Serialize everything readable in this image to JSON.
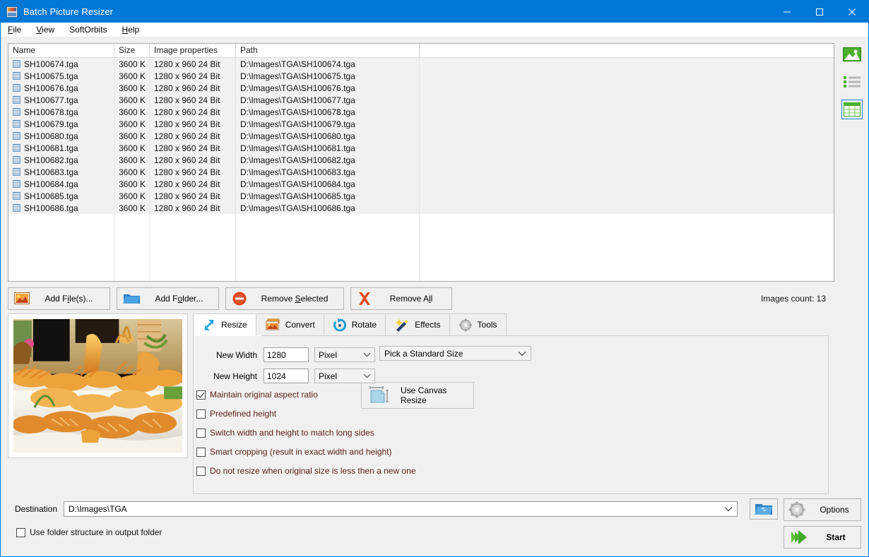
{
  "window": {
    "title": "Batch Picture Resizer",
    "app_icon": "app-icon",
    "minimize": "minimize-icon",
    "maximize": "maximize-icon",
    "close": "close-icon"
  },
  "menubar": {
    "items": [
      {
        "label": "File",
        "accel": "F"
      },
      {
        "label": "View",
        "accel": "V"
      },
      {
        "label": "SoftOrbits",
        "accel": "S"
      },
      {
        "label": "Help",
        "accel": "H"
      }
    ]
  },
  "filelist": {
    "columns": [
      "Name",
      "Size",
      "Image properties",
      "Path"
    ],
    "rows": [
      {
        "name": "SH100674.tga",
        "size": "3600 K",
        "props": "1280 x 960   24 Bit",
        "path": "D:\\Images\\TGA\\SH100674.tga"
      },
      {
        "name": "SH100675.tga",
        "size": "3600 K",
        "props": "1280 x 960   24 Bit",
        "path": "D:\\Images\\TGA\\SH100675.tga"
      },
      {
        "name": "SH100676.tga",
        "size": "3600 K",
        "props": "1280 x 960   24 Bit",
        "path": "D:\\Images\\TGA\\SH100676.tga"
      },
      {
        "name": "SH100677.tga",
        "size": "3600 K",
        "props": "1280 x 960   24 Bit",
        "path": "D:\\Images\\TGA\\SH100677.tga"
      },
      {
        "name": "SH100678.tga",
        "size": "3600 K",
        "props": "1280 x 960   24 Bit",
        "path": "D:\\Images\\TGA\\SH100678.tga"
      },
      {
        "name": "SH100679.tga",
        "size": "3600 K",
        "props": "1280 x 960   24 Bit",
        "path": "D:\\Images\\TGA\\SH100679.tga"
      },
      {
        "name": "SH100680.tga",
        "size": "3600 K",
        "props": "1280 x 960   24 Bit",
        "path": "D:\\Images\\TGA\\SH100680.tga"
      },
      {
        "name": "SH100681.tga",
        "size": "3600 K",
        "props": "1280 x 960   24 Bit",
        "path": "D:\\Images\\TGA\\SH100681.tga"
      },
      {
        "name": "SH100682.tga",
        "size": "3600 K",
        "props": "1280 x 960   24 Bit",
        "path": "D:\\Images\\TGA\\SH100682.tga"
      },
      {
        "name": "SH100683.tga",
        "size": "3600 K",
        "props": "1280 x 960   24 Bit",
        "path": "D:\\Images\\TGA\\SH100683.tga"
      },
      {
        "name": "SH100684.tga",
        "size": "3600 K",
        "props": "1280 x 960   24 Bit",
        "path": "D:\\Images\\TGA\\SH100684.tga"
      },
      {
        "name": "SH100685.tga",
        "size": "3600 K",
        "props": "1280 x 960   24 Bit",
        "path": "D:\\Images\\TGA\\SH100685.tga"
      },
      {
        "name": "SH100686.tga",
        "size": "3600 K",
        "props": "1280 x 960   24 Bit",
        "path": "D:\\Images\\TGA\\SH100686.tga"
      }
    ]
  },
  "view_rail": {
    "items": [
      {
        "icon": "thumbnail-view-icon",
        "selected": false
      },
      {
        "icon": "list-view-icon",
        "selected": false
      },
      {
        "icon": "details-view-icon",
        "selected": true
      }
    ]
  },
  "actions": {
    "add_files": "Add File(s)...",
    "add_folder": "Add Folder...",
    "remove_selected": "Remove Selected",
    "remove_all": "Remove All",
    "images_count": "Images count: 13"
  },
  "tabs": [
    {
      "label": "Resize",
      "icon": "resize-arrows-icon",
      "active": true
    },
    {
      "label": "Convert",
      "icon": "convert-image-icon",
      "active": false
    },
    {
      "label": "Rotate",
      "icon": "rotate-icon",
      "active": false
    },
    {
      "label": "Effects",
      "icon": "magic-wand-icon",
      "active": false
    },
    {
      "label": "Tools",
      "icon": "gear-icon",
      "active": false
    }
  ],
  "resize_panel": {
    "new_width_label": "New Width",
    "new_width_value": "1280",
    "new_width_unit": "Pixel",
    "new_height_label": "New Height",
    "new_height_value": "1024",
    "new_height_unit": "Pixel",
    "standard_size": "Pick a Standard Size",
    "canvas_resize": "Use Canvas Resize",
    "checkboxes": [
      {
        "label": "Maintain original aspect ratio",
        "checked": true
      },
      {
        "label": "Predefined height",
        "checked": false
      },
      {
        "label": "Switch width and height to match long sides",
        "checked": false
      },
      {
        "label": "Smart cropping (result in exact width and height)",
        "checked": false
      },
      {
        "label": "Do not resize when original size is less then a new one",
        "checked": false
      }
    ]
  },
  "footer": {
    "destination_label": "Destination",
    "destination_value": "D:\\Images\\TGA",
    "use_folder_structure": "Use folder structure in output folder",
    "use_folder_structure_checked": false,
    "browse_icon": "browse-folder-icon",
    "options": "Options",
    "start": "Start"
  },
  "colors": {
    "titlebar": "#0078d7",
    "accent_green": "#4caf2a",
    "window_bg": "#f0f0f0"
  }
}
